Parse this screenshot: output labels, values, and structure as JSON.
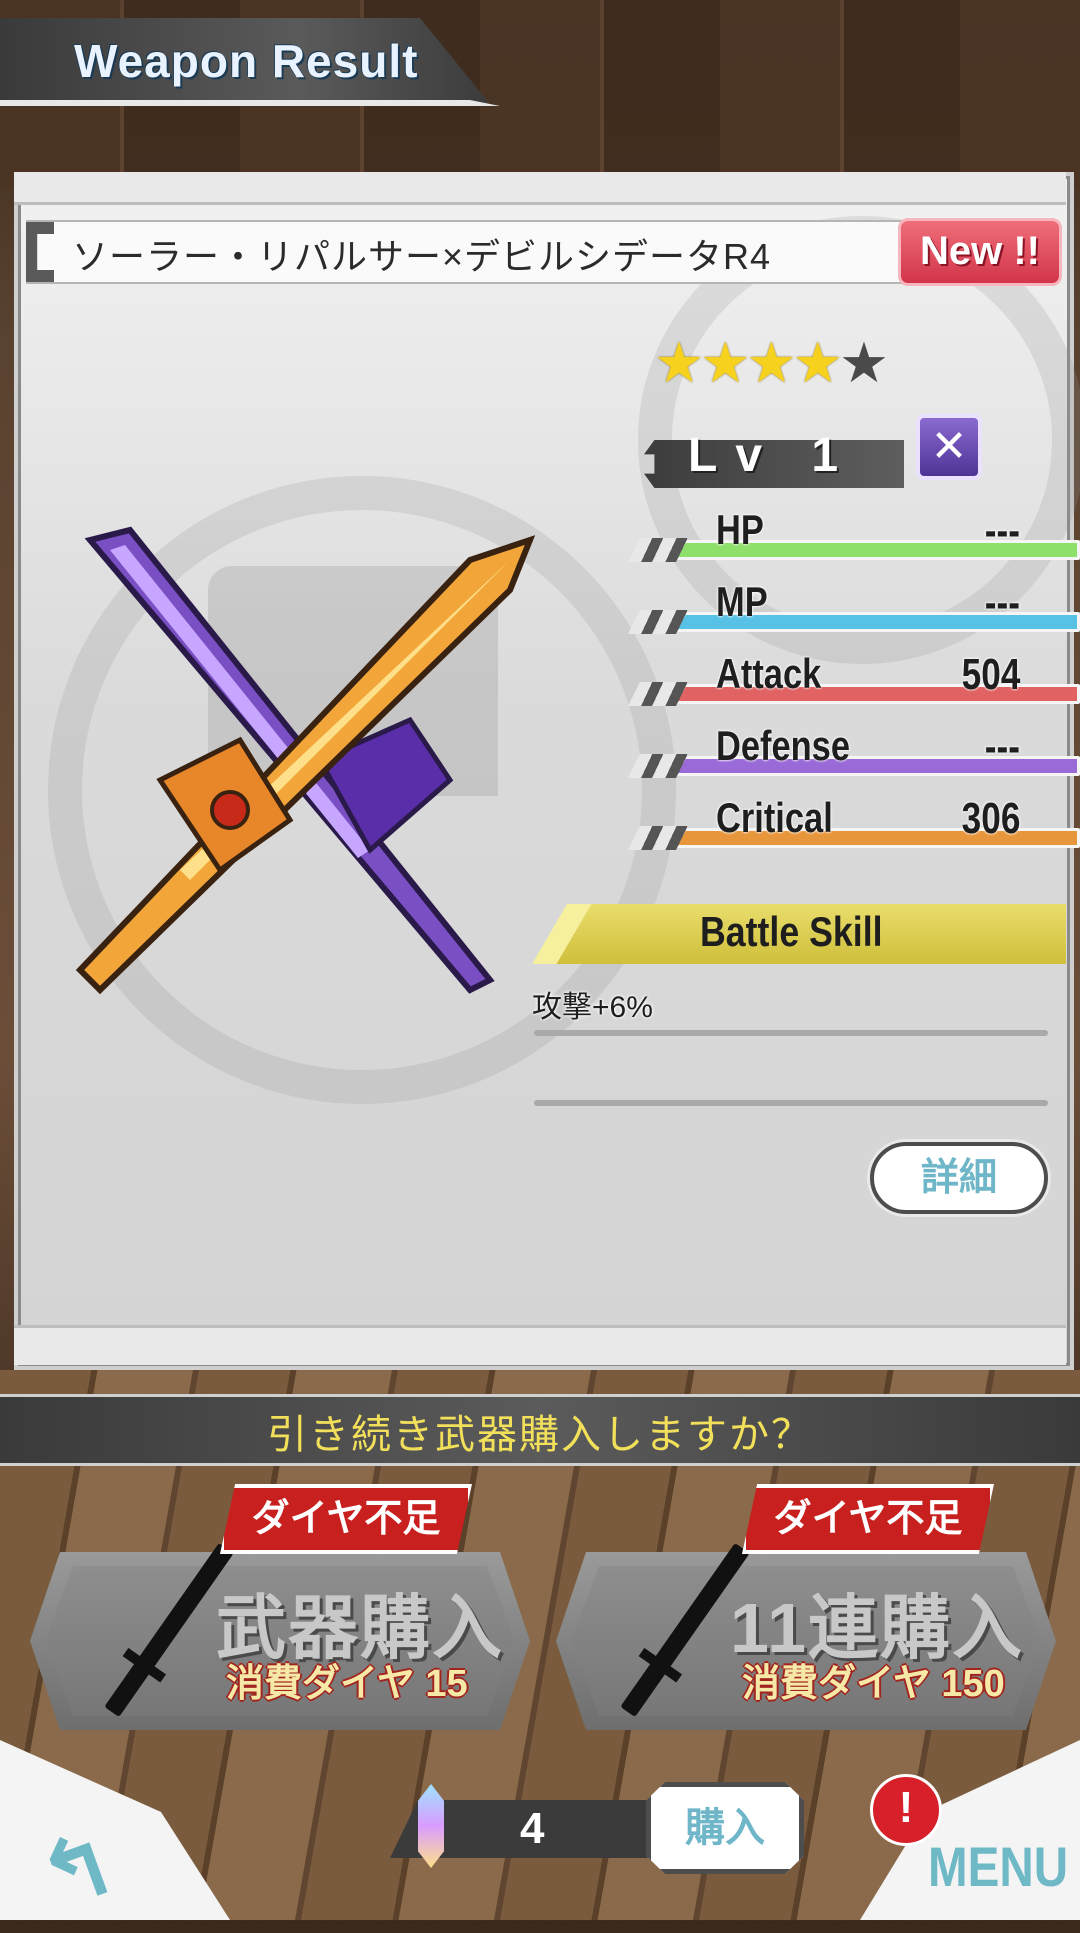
{
  "header": {
    "title": "Weapon Result"
  },
  "weapon": {
    "name": "ソーラー・リパルサー×デビルシデータR4",
    "new_badge": "New !!",
    "stars_filled": 4,
    "stars_total": 5,
    "level_label": "Lv",
    "level_value": "1",
    "lv_icon": "crossed-swords-icon",
    "stats": [
      {
        "label": "HP",
        "value": "---",
        "color": "#8fe06a"
      },
      {
        "label": "MP",
        "value": "---",
        "color": "#58c2e6"
      },
      {
        "label": "Attack",
        "value": "504",
        "color": "#e06262"
      },
      {
        "label": "Defense",
        "value": "---",
        "color": "#9a6ad8"
      },
      {
        "label": "Critical",
        "value": "306",
        "color": "#e8963c"
      }
    ],
    "battle_skill_label": "Battle Skill",
    "battle_skill_desc": "攻撃+6%",
    "detail_button": "詳細"
  },
  "prompt": {
    "question": "引き続き武器購入しますか？"
  },
  "purchase": {
    "single": {
      "tag": "ダイヤ不足",
      "title": "武器購入",
      "cost": "消費ダイヤ 15"
    },
    "multi": {
      "tag": "ダイヤ不足",
      "title": "11連購入",
      "cost": "消費ダイヤ 150"
    }
  },
  "footer": {
    "gem_count": "4",
    "buy_label": "購入",
    "menu_label": "MENU",
    "alert_mark": "!",
    "back_icon": "back-arrow-icon"
  },
  "colors": {
    "accent": "#6fb8c6",
    "skill_bar": "#e0d24e",
    "warning_red": "#c8201f"
  }
}
